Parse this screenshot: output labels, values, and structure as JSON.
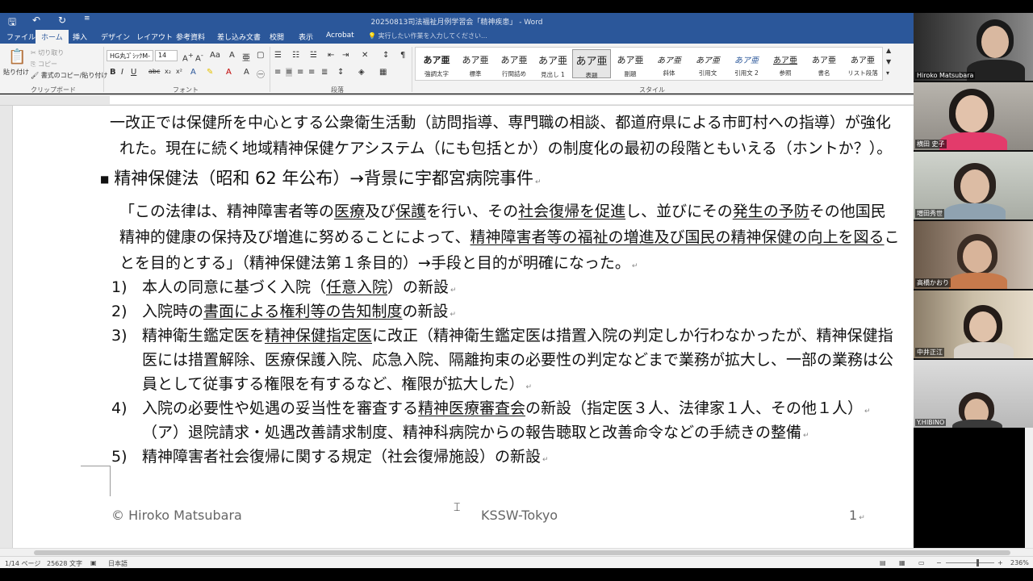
{
  "titlebar": {
    "doc_title": "20250813司法福祉月例学習会「精神疾患」 - Word"
  },
  "tabs": {
    "items": [
      "ファイル",
      "ホーム",
      "挿入",
      "デザイン",
      "レイアウト",
      "参考資料",
      "差し込み文書",
      "校閲",
      "表示",
      "Acrobat"
    ],
    "tell_me": "実行したい作業を入力してください..."
  },
  "ribbon": {
    "clipboard": {
      "paste": "貼り付け",
      "cut": "切り取り",
      "copy": "コピー",
      "format_painter": "書式のコピー/貼り付け",
      "label": "クリップボード"
    },
    "font": {
      "name": "HG丸ｺﾞｼｯｸM-",
      "size": "14",
      "label": "フォント"
    },
    "paragraph": {
      "label": "段落"
    },
    "styles": {
      "label": "スタイル",
      "items": [
        {
          "sample": "あア亜",
          "name": "強調太字"
        },
        {
          "sample": "あア亜",
          "name": "標準"
        },
        {
          "sample": "あア亜",
          "name": "行間詰め"
        },
        {
          "sample": "あア亜",
          "name": "見出し 1"
        },
        {
          "sample": "あア亜",
          "name": "表題"
        },
        {
          "sample": "あア亜",
          "name": "副題"
        },
        {
          "sample": "あア亜",
          "name": "斜体"
        },
        {
          "sample": "あア亜",
          "name": "引用文"
        },
        {
          "sample": "あア亜",
          "name": "引用文 2"
        },
        {
          "sample": "あア亜",
          "name": "参照"
        },
        {
          "sample": "あア亜",
          "name": "書名"
        },
        {
          "sample": "あア亜",
          "name": "リスト段落"
        }
      ]
    }
  },
  "document": {
    "line1": "一改正では保健所を中心とする公衆衛生活動（訪問指導、専門職の相談、都道府県による市町村への指導）が強化",
    "line2": "れた。現在に続く地域精神保健ケアシステム（にも包括とか）の制度化の最初の段階ともいえる（ホントか？）。",
    "heading": "精神保健法（昭和 62 年公布）→背景に宇都宮病院事件",
    "q1a": "「この法律は、精神障害者等の",
    "q1b": "医療",
    "q1c": "及び",
    "q1d": "保護",
    "q1e": "を行い、その",
    "q1f": "社会復帰を促進",
    "q1g": "し、並びにその",
    "q1h": "発生の予防",
    "q1i": "その他国民",
    "q2a": "精神的健康の保持及び増進に努めることによって、",
    "q2b": "精神障害者等の福祉の増進及び国民の精神保健の向上を図る",
    "q2c": "こ",
    "q3": "とを目的とする」（精神保健法第１条目的）→手段と目的が明確になった。",
    "i1_num": "1)",
    "i1a": "本人の同意に基づく入院（",
    "i1b": "任意入院",
    "i1c": "）の新設",
    "i2_num": "2)",
    "i2a": "入院時の",
    "i2b": "書面による権利等の告知制度",
    "i2c": "の新設",
    "i3_num": "3)",
    "i3a": "精神衛生鑑定医を",
    "i3b": "精神保健指定医",
    "i3c": "に改正（精神衛生鑑定医は措置入院の判定しか行わなかったが、精神保健指",
    "i3d": "医には措置解除、医療保護入院、応急入院、隔離拘束の必要性の判定などまで業務が拡大し、一部の業務は公",
    "i3e": "員として従事する権限を有するなど、権限が拡大した）",
    "i4_num": "4)",
    "i4a": "入院の必要性や処遇の妥当性を審査する",
    "i4b": "精神医療審査会",
    "i4c": "の新設（指定医３人、法律家１人、その他１人）",
    "i4d": "（ア）退院請求・処遇改善請求制度、精神科病院からの報告聴取と改善命令などの手続きの整備",
    "i5_num": "5)",
    "i5a": "精神障害者社会復帰に関する規定（社会復帰施設）の新設",
    "footer_left": "© Hiroko Matsubara",
    "footer_center": "KSSW-Tokyo",
    "footer_right": "1"
  },
  "statusbar": {
    "page": "1/14 ページ",
    "words": "25628 文字",
    "lang": "日本語",
    "zoom": "236%"
  },
  "participants": [
    "Hiroko Matsubara",
    "横田 史子",
    "増田秀世",
    "高橋かおり",
    "中井正江",
    "Y.HIBINO"
  ]
}
